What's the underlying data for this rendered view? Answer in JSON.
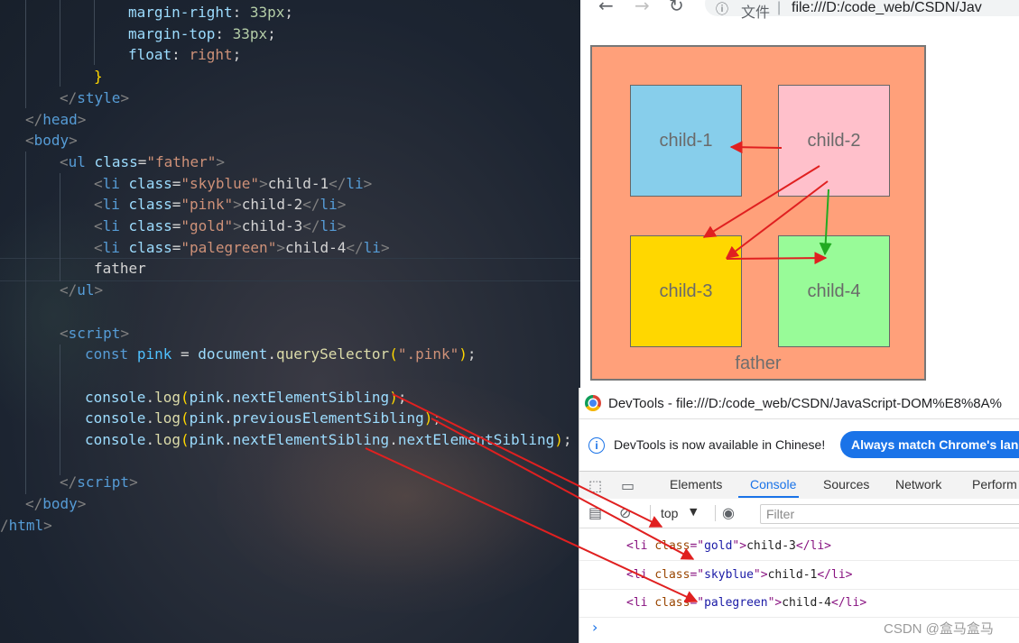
{
  "editor": {
    "lines": [
      {
        "indent": 142,
        "tokens": [
          [
            "css",
            "margin-right"
          ],
          [
            "txt",
            ": "
          ],
          [
            "num",
            "33px"
          ],
          [
            "txt",
            ";"
          ]
        ]
      },
      {
        "indent": 142,
        "tokens": [
          [
            "css",
            "margin-top"
          ],
          [
            "txt",
            ": "
          ],
          [
            "num",
            "33px"
          ],
          [
            "txt",
            ";"
          ]
        ]
      },
      {
        "indent": 142,
        "tokens": [
          [
            "css",
            "float"
          ],
          [
            "txt",
            ": "
          ],
          [
            "str",
            "right"
          ],
          [
            "txt",
            ";"
          ]
        ]
      },
      {
        "indent": 104,
        "tokens": [
          [
            "br1",
            "}"
          ]
        ]
      },
      {
        "indent": 66,
        "tokens": [
          [
            "punc",
            "</"
          ],
          [
            "tag",
            "style"
          ],
          [
            "punc",
            ">"
          ]
        ]
      },
      {
        "indent": 28,
        "tokens": [
          [
            "punc",
            "</"
          ],
          [
            "tag",
            "head"
          ],
          [
            "punc",
            ">"
          ]
        ]
      },
      {
        "indent": 28,
        "tokens": [
          [
            "punc",
            "<"
          ],
          [
            "tag",
            "body"
          ],
          [
            "punc",
            ">"
          ]
        ]
      },
      {
        "indent": 66,
        "tokens": [
          [
            "punc",
            "<"
          ],
          [
            "tag",
            "ul"
          ],
          [
            "txt",
            " "
          ],
          [
            "attr",
            "class"
          ],
          [
            "txt",
            "="
          ],
          [
            "str",
            "\"father\""
          ],
          [
            "punc",
            ">"
          ]
        ]
      },
      {
        "indent": 104,
        "tokens": [
          [
            "punc",
            "<"
          ],
          [
            "tag",
            "li"
          ],
          [
            "txt",
            " "
          ],
          [
            "attr",
            "class"
          ],
          [
            "txt",
            "="
          ],
          [
            "str",
            "\"skyblue\""
          ],
          [
            "punc",
            ">"
          ],
          [
            "txt",
            "child-1"
          ],
          [
            "punc",
            "</"
          ],
          [
            "tag",
            "li"
          ],
          [
            "punc",
            ">"
          ]
        ]
      },
      {
        "indent": 104,
        "tokens": [
          [
            "punc",
            "<"
          ],
          [
            "tag",
            "li"
          ],
          [
            "txt",
            " "
          ],
          [
            "attr",
            "class"
          ],
          [
            "txt",
            "="
          ],
          [
            "str",
            "\"pink\""
          ],
          [
            "punc",
            ">"
          ],
          [
            "txt",
            "child-2"
          ],
          [
            "punc",
            "</"
          ],
          [
            "tag",
            "li"
          ],
          [
            "punc",
            ">"
          ]
        ]
      },
      {
        "indent": 104,
        "tokens": [
          [
            "punc",
            "<"
          ],
          [
            "tag",
            "li"
          ],
          [
            "txt",
            " "
          ],
          [
            "attr",
            "class"
          ],
          [
            "txt",
            "="
          ],
          [
            "str",
            "\"gold\""
          ],
          [
            "punc",
            ">"
          ],
          [
            "txt",
            "child-3"
          ],
          [
            "punc",
            "</"
          ],
          [
            "tag",
            "li"
          ],
          [
            "punc",
            ">"
          ]
        ]
      },
      {
        "indent": 104,
        "tokens": [
          [
            "punc",
            "<"
          ],
          [
            "tag",
            "li"
          ],
          [
            "txt",
            " "
          ],
          [
            "attr",
            "class"
          ],
          [
            "txt",
            "="
          ],
          [
            "str",
            "\"palegreen\""
          ],
          [
            "punc",
            ">"
          ],
          [
            "txt",
            "child-4"
          ],
          [
            "punc",
            "</"
          ],
          [
            "tag",
            "li"
          ],
          [
            "punc",
            ">"
          ]
        ]
      },
      {
        "indent": 104,
        "tokens": [
          [
            "txt",
            "father"
          ]
        ]
      },
      {
        "indent": 66,
        "tokens": [
          [
            "punc",
            "</"
          ],
          [
            "tag",
            "ul"
          ],
          [
            "punc",
            ">"
          ]
        ]
      },
      {
        "indent": 0,
        "tokens": []
      },
      {
        "indent": 66,
        "tokens": [
          [
            "punc",
            "<"
          ],
          [
            "tag",
            "script"
          ],
          [
            "punc",
            ">"
          ]
        ]
      },
      {
        "indent": 94,
        "tokens": [
          [
            "kw",
            "const"
          ],
          [
            "txt",
            " "
          ],
          [
            "var",
            "pink"
          ],
          [
            "txt",
            " = "
          ],
          [
            "attr",
            "document"
          ],
          [
            "txt",
            "."
          ],
          [
            "fn",
            "querySelector"
          ],
          [
            "br1",
            "("
          ],
          [
            "str",
            "\".pink\""
          ],
          [
            "br1",
            ")"
          ],
          [
            "txt",
            ";"
          ]
        ]
      },
      {
        "indent": 0,
        "tokens": []
      },
      {
        "indent": 94,
        "tokens": [
          [
            "attr",
            "console"
          ],
          [
            "txt",
            "."
          ],
          [
            "fn",
            "log"
          ],
          [
            "br1",
            "("
          ],
          [
            "attr",
            "pink"
          ],
          [
            "txt",
            "."
          ],
          [
            "attr",
            "nextElementSibling"
          ],
          [
            "br1",
            ")"
          ],
          [
            "txt",
            ";"
          ]
        ]
      },
      {
        "indent": 94,
        "tokens": [
          [
            "attr",
            "console"
          ],
          [
            "txt",
            "."
          ],
          [
            "fn",
            "log"
          ],
          [
            "br1",
            "("
          ],
          [
            "attr",
            "pink"
          ],
          [
            "txt",
            "."
          ],
          [
            "attr",
            "previousElementSibling"
          ],
          [
            "br1",
            ")"
          ],
          [
            "txt",
            ";"
          ]
        ]
      },
      {
        "indent": 94,
        "tokens": [
          [
            "attr",
            "console"
          ],
          [
            "txt",
            "."
          ],
          [
            "fn",
            "log"
          ],
          [
            "br1",
            "("
          ],
          [
            "attr",
            "pink"
          ],
          [
            "txt",
            "."
          ],
          [
            "attr",
            "nextElementSibling"
          ],
          [
            "txt",
            "."
          ],
          [
            "attr",
            "nextElementSibling"
          ],
          [
            "br1",
            ")"
          ],
          [
            "txt",
            ";"
          ]
        ]
      },
      {
        "indent": 0,
        "tokens": []
      },
      {
        "indent": 66,
        "tokens": [
          [
            "punc",
            "</"
          ],
          [
            "tag",
            "script"
          ],
          [
            "punc",
            ">"
          ]
        ]
      },
      {
        "indent": 28,
        "tokens": [
          [
            "punc",
            "</"
          ],
          [
            "tag",
            "body"
          ],
          [
            "punc",
            ">"
          ]
        ]
      },
      {
        "indent": 0,
        "tokens": [
          [
            "punc",
            "/"
          ],
          [
            "tag",
            "html"
          ],
          [
            "punc",
            ">"
          ]
        ]
      }
    ]
  },
  "browser": {
    "back_icon": "←",
    "forward_icon": "→",
    "reload_icon": "↻",
    "info_icon": "ⓘ",
    "address_label": "文件",
    "address_sep": "|",
    "url": "file:///D:/code_web/CSDN/Jav",
    "children": [
      {
        "label": "child-1",
        "color": "#87ceeb"
      },
      {
        "label": "child-2",
        "color": "#ffc0cb"
      },
      {
        "label": "child-3",
        "color": "#ffd700"
      },
      {
        "label": "child-4",
        "color": "#98fb98"
      }
    ],
    "father_label": "father",
    "father_color": "#ffa07a"
  },
  "devtools": {
    "title": "DevTools - file:///D:/code_web/CSDN/JavaScript-DOM%E8%8A%",
    "info_icon": "i",
    "info_message": "DevTools is now available in Chinese!",
    "info_button": "Always match Chrome's lang",
    "tabs": [
      "Elements",
      "Console",
      "Sources",
      "Network",
      "Perform"
    ],
    "active_tab": "Console",
    "inspect_icon": "⬚",
    "device_icon": "▭",
    "sidebar_icon": "▤",
    "clear_icon": "⊘",
    "context": "top",
    "caret_icon": "▼",
    "eye_icon": "◉",
    "filter_placeholder": "Filter",
    "logs": [
      {
        "cls": "gold",
        "text": "child-3"
      },
      {
        "cls": "skyblue",
        "text": "child-1"
      },
      {
        "cls": "palegreen",
        "text": "child-4"
      }
    ],
    "prompt_icon": "›"
  },
  "watermark": "CSDN @盒马盒马",
  "colors": {
    "arrow_red": "#e02020",
    "arrow_green": "#22aa22",
    "accent": "#1a73e8"
  }
}
